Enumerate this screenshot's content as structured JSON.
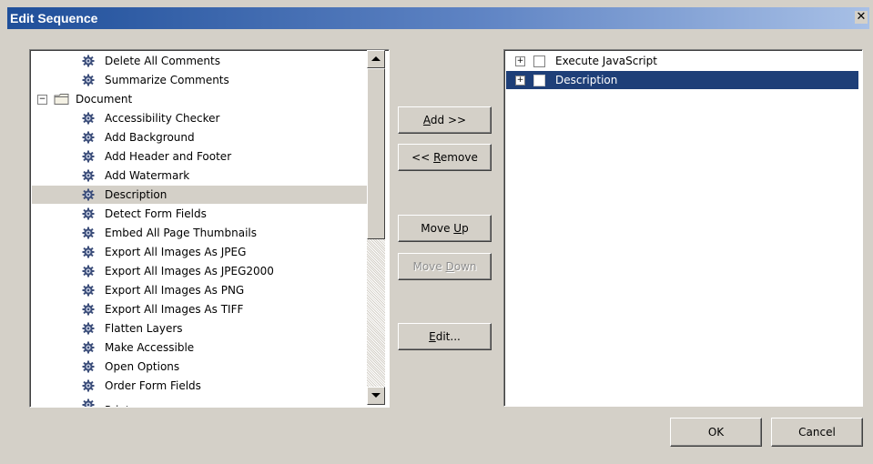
{
  "window": {
    "title": "Edit Sequence",
    "close_glyph": "✕"
  },
  "commands_list": {
    "items": [
      {
        "label": "Delete All Comments",
        "type": "command",
        "level": 1
      },
      {
        "label": "Summarize Comments",
        "type": "command",
        "level": 1
      },
      {
        "label": "Document",
        "type": "folder",
        "level": 0,
        "expanded": true
      },
      {
        "label": "Accessibility Checker",
        "type": "command",
        "level": 1
      },
      {
        "label": "Add Background",
        "type": "command",
        "level": 1
      },
      {
        "label": "Add Header and Footer",
        "type": "command",
        "level": 1
      },
      {
        "label": "Add Watermark",
        "type": "command",
        "level": 1
      },
      {
        "label": "Description",
        "type": "command",
        "level": 1,
        "selected": true
      },
      {
        "label": "Detect Form Fields",
        "type": "command",
        "level": 1
      },
      {
        "label": "Embed All Page Thumbnails",
        "type": "command",
        "level": 1
      },
      {
        "label": "Export All Images As JPEG",
        "type": "command",
        "level": 1
      },
      {
        "label": "Export All Images As JPEG2000",
        "type": "command",
        "level": 1
      },
      {
        "label": "Export All Images As PNG",
        "type": "command",
        "level": 1
      },
      {
        "label": "Export All Images As TIFF",
        "type": "command",
        "level": 1
      },
      {
        "label": "Flatten Layers",
        "type": "command",
        "level": 1
      },
      {
        "label": "Make Accessible",
        "type": "command",
        "level": 1
      },
      {
        "label": "Open Options",
        "type": "command",
        "level": 1
      },
      {
        "label": "Order Form Fields",
        "type": "command",
        "level": 1
      },
      {
        "label": "Print",
        "type": "command",
        "level": 1,
        "partial": true
      }
    ]
  },
  "buttons": {
    "add": {
      "prefix": "",
      "mnemonic": "A",
      "suffix": "dd >>"
    },
    "remove": {
      "prefix": "<< ",
      "mnemonic": "R",
      "suffix": "emove"
    },
    "move_up": {
      "prefix": "Move ",
      "mnemonic": "U",
      "suffix": "p"
    },
    "move_down": {
      "prefix": "Move ",
      "mnemonic": "D",
      "suffix": "own",
      "disabled": true
    },
    "edit": {
      "prefix": "",
      "mnemonic": "E",
      "suffix": "dit..."
    },
    "ok": "OK",
    "cancel": "Cancel"
  },
  "sequence_list": {
    "items": [
      {
        "label": "Execute JavaScript",
        "selected": false,
        "checked": false
      },
      {
        "label": "Description",
        "selected": true,
        "checked": false
      }
    ]
  },
  "colors": {
    "dialog_bg": "#d4d0c8",
    "title_start": "#1f4f9a",
    "selection_blue": "#1e3f78"
  }
}
